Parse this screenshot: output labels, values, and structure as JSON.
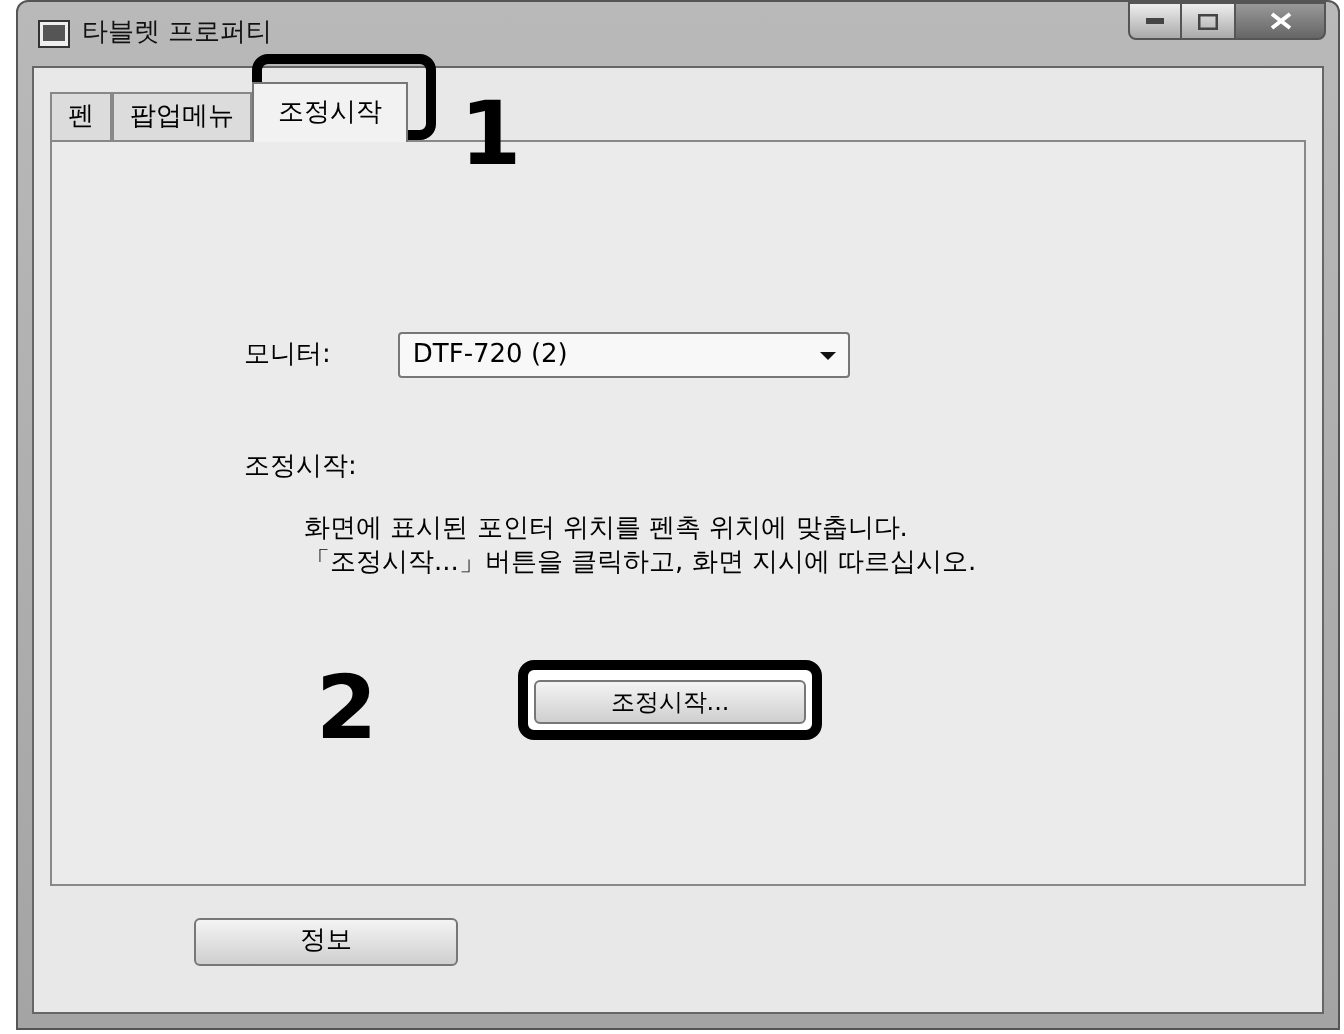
{
  "window": {
    "title": "타블렛 프로퍼티"
  },
  "tabs": [
    {
      "label": "펜",
      "selected": false
    },
    {
      "label": "팝업메뉴",
      "selected": false
    },
    {
      "label": "조정시작",
      "selected": true
    }
  ],
  "monitor": {
    "label": "모니터:",
    "value": "DTF-720 (2)"
  },
  "calibration": {
    "heading": "조정시작:",
    "lines": [
      "화면에 표시된 포인터 위치를 펜촉 위치에 맞춥니다.",
      "「조정시작...」버튼을 클릭하고, 화면 지시에 따르십시오."
    ],
    "button": "조정시작..."
  },
  "about_button": "정보",
  "callouts": [
    "1",
    "2"
  ]
}
